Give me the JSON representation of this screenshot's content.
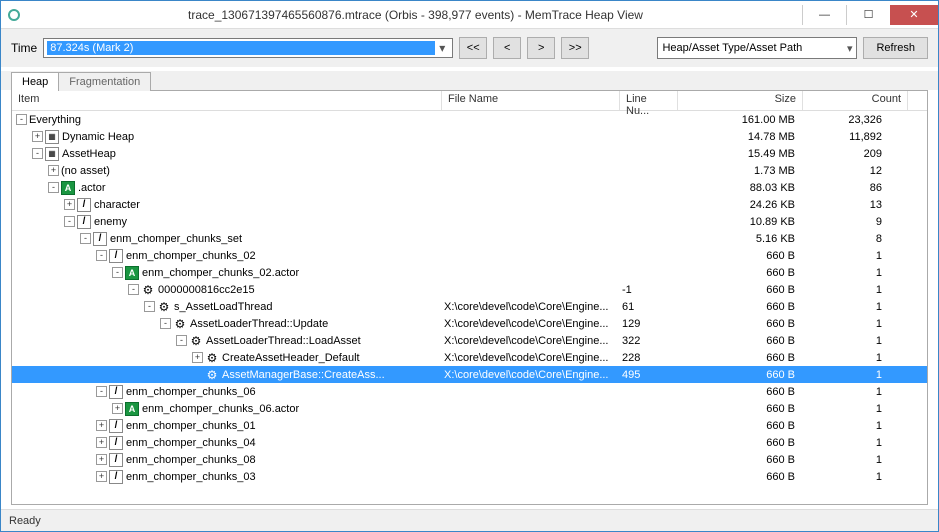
{
  "window": {
    "title": "trace_130671397465560876.mtrace (Orbis - 398,977 events) - MemTrace Heap View"
  },
  "toolbar": {
    "time_label": "Time",
    "time_value": "87.324s (Mark 2)",
    "nav_first": "<<",
    "nav_prev": "<",
    "nav_next": ">",
    "nav_last": ">>",
    "group_by": "Heap/Asset Type/Asset Path",
    "refresh": "Refresh"
  },
  "tabs": {
    "heap": "Heap",
    "frag": "Fragmentation"
  },
  "columns": {
    "item": "Item",
    "file": "File Name",
    "line": "Line Nu...",
    "size": "Size",
    "count": "Count"
  },
  "rows": [
    {
      "indent": 0,
      "exp": "-",
      "ico": "",
      "label": "Everything",
      "file": "",
      "line": "",
      "size": "161.00 MB",
      "count": "23,326"
    },
    {
      "indent": 1,
      "exp": "+",
      "ico": "folder",
      "label": "Dynamic Heap",
      "file": "",
      "line": "",
      "size": "14.78 MB",
      "count": "11,892"
    },
    {
      "indent": 1,
      "exp": "-",
      "ico": "folder",
      "label": "AssetHeap",
      "file": "",
      "line": "",
      "size": "15.49 MB",
      "count": "209"
    },
    {
      "indent": 2,
      "exp": "+",
      "ico": "",
      "label": "(no asset)",
      "file": "",
      "line": "",
      "size": "1.73 MB",
      "count": "12"
    },
    {
      "indent": 2,
      "exp": "-",
      "ico": "a",
      "label": ".actor",
      "file": "",
      "line": "",
      "size": "88.03 KB",
      "count": "86"
    },
    {
      "indent": 3,
      "exp": "+",
      "ico": "slash",
      "label": "character",
      "file": "",
      "line": "",
      "size": "24.26 KB",
      "count": "13"
    },
    {
      "indent": 3,
      "exp": "-",
      "ico": "slash",
      "label": "enemy",
      "file": "",
      "line": "",
      "size": "10.89 KB",
      "count": "9"
    },
    {
      "indent": 4,
      "exp": "-",
      "ico": "slash",
      "label": "enm_chomper_chunks_set",
      "file": "",
      "line": "",
      "size": "5.16 KB",
      "count": "8"
    },
    {
      "indent": 5,
      "exp": "-",
      "ico": "slash",
      "label": "enm_chomper_chunks_02",
      "file": "",
      "line": "",
      "size": "660 B",
      "count": "1"
    },
    {
      "indent": 6,
      "exp": "-",
      "ico": "a",
      "label": "enm_chomper_chunks_02.actor",
      "file": "",
      "line": "",
      "size": "660 B",
      "count": "1"
    },
    {
      "indent": 7,
      "exp": "-",
      "ico": "gear",
      "label": "0000000816cc2e15",
      "file": "",
      "line": "-1",
      "size": "660 B",
      "count": "1"
    },
    {
      "indent": 8,
      "exp": "-",
      "ico": "gear",
      "label": "s_AssetLoadThread",
      "file": "X:\\core\\devel\\code\\Core\\Engine...",
      "line": "61",
      "size": "660 B",
      "count": "1"
    },
    {
      "indent": 9,
      "exp": "-",
      "ico": "gear",
      "label": "AssetLoaderThread::Update",
      "file": "X:\\core\\devel\\code\\Core\\Engine...",
      "line": "129",
      "size": "660 B",
      "count": "1"
    },
    {
      "indent": 10,
      "exp": "-",
      "ico": "gear",
      "label": "AssetLoaderThread::LoadAsset",
      "file": "X:\\core\\devel\\code\\Core\\Engine...",
      "line": "322",
      "size": "660 B",
      "count": "1"
    },
    {
      "indent": 11,
      "exp": "+",
      "ico": "gear",
      "label": "CreateAssetHeader_Default",
      "file": "X:\\core\\devel\\code\\Core\\Engine...",
      "line": "228",
      "size": "660 B",
      "count": "1"
    },
    {
      "indent": 11,
      "exp": "",
      "ico": "gear",
      "label": "AssetManagerBase::CreateAss...",
      "file": "X:\\core\\devel\\code\\Core\\Engine...",
      "line": "495",
      "size": "660 B",
      "count": "1",
      "selected": true
    },
    {
      "indent": 5,
      "exp": "-",
      "ico": "slash",
      "label": "enm_chomper_chunks_06",
      "file": "",
      "line": "",
      "size": "660 B",
      "count": "1"
    },
    {
      "indent": 6,
      "exp": "+",
      "ico": "a",
      "label": "enm_chomper_chunks_06.actor",
      "file": "",
      "line": "",
      "size": "660 B",
      "count": "1"
    },
    {
      "indent": 5,
      "exp": "+",
      "ico": "slash",
      "label": "enm_chomper_chunks_01",
      "file": "",
      "line": "",
      "size": "660 B",
      "count": "1"
    },
    {
      "indent": 5,
      "exp": "+",
      "ico": "slash",
      "label": "enm_chomper_chunks_04",
      "file": "",
      "line": "",
      "size": "660 B",
      "count": "1"
    },
    {
      "indent": 5,
      "exp": "+",
      "ico": "slash",
      "label": "enm_chomper_chunks_08",
      "file": "",
      "line": "",
      "size": "660 B",
      "count": "1"
    },
    {
      "indent": 5,
      "exp": "+",
      "ico": "slash",
      "label": "enm_chomper_chunks_03",
      "file": "",
      "line": "",
      "size": "660 B",
      "count": "1"
    }
  ],
  "status": "Ready"
}
